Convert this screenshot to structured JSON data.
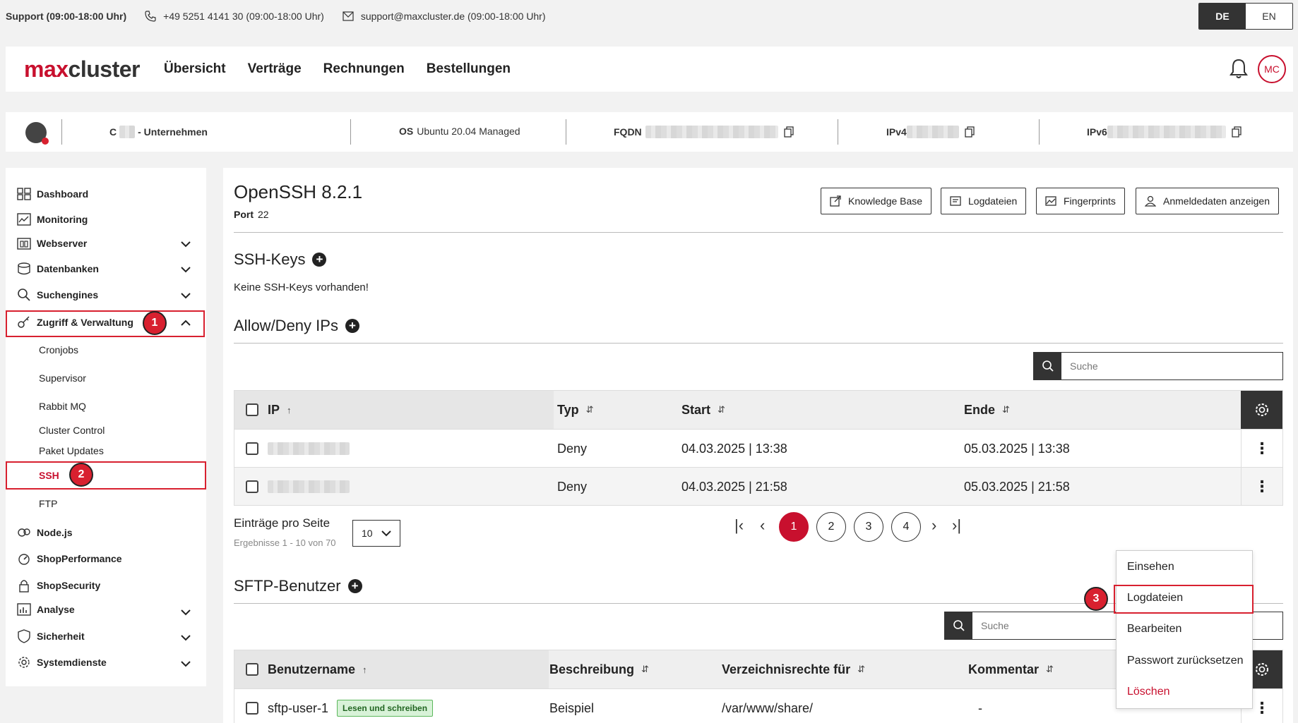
{
  "support": {
    "title": "Support (09:00-18:00 Uhr)",
    "phone": "+49 5251 4141 30 (09:00-18:00 Uhr)",
    "email": "support@maxcluster.de (09:00-18:00 Uhr)"
  },
  "lang": {
    "de": "DE",
    "en": "EN"
  },
  "header": {
    "logo_a": "max",
    "logo_b": "cluster",
    "nav": [
      "Übersicht",
      "Verträge",
      "Rechnungen",
      "Bestellungen"
    ],
    "avatar": "MC"
  },
  "server": {
    "name_prefix": "C",
    "name_suffix": "- Unternehmen",
    "os_label": "OS",
    "os_value": "Ubuntu 20.04 Managed",
    "fqdn_label": "FQDN",
    "ipv4_label": "IPv4",
    "ipv6_label": "IPv6"
  },
  "sidebar": {
    "items": [
      "Dashboard",
      "Monitoring",
      "Webserver",
      "Datenbanken",
      "Suchengines",
      "Zugriff & Verwaltung",
      "Node.js",
      "ShopPerformance",
      "ShopSecurity",
      "Analyse",
      "Sicherheit",
      "Systemdienste"
    ],
    "sub": [
      "Cronjobs",
      "Supervisor",
      "Rabbit MQ",
      "Cluster Control",
      "Paket Updates",
      "SSH",
      "FTP"
    ],
    "badge1": "1",
    "badge2": "2"
  },
  "main": {
    "title": "OpenSSH 8.2.1",
    "port_label": "Port",
    "port_value": "22",
    "buttons": [
      "Knowledge Base",
      "Logdateien",
      "Fingerprints",
      "Anmeldedaten anzeigen"
    ],
    "ssh_keys_title": "SSH-Keys",
    "ssh_keys_empty": "Keine SSH-Keys vorhanden!",
    "allow_title": "Allow/Deny IPs",
    "search_placeholder": "Suche",
    "ip_table": {
      "headers": [
        "IP",
        "Typ",
        "Start",
        "Ende"
      ],
      "sort": [
        "↑",
        "⇵",
        "⇵",
        "⇵"
      ],
      "rows": [
        {
          "typ": "Deny",
          "start": "04.03.2025 | 13:38",
          "ende": "05.03.2025 | 13:38"
        },
        {
          "typ": "Deny",
          "start": "04.03.2025 | 21:58",
          "ende": "05.03.2025 | 21:58"
        }
      ]
    },
    "per_page_label": "Einträge pro Seite",
    "results": "Ergebnisse 1 - 10 von 70",
    "per_page_value": "10",
    "pages": [
      "1",
      "2",
      "3",
      "4"
    ],
    "sftp_title": "SFTP-Benutzer",
    "sftp_table": {
      "headers": [
        "Benutzername",
        "Beschreibung",
        "Verzeichnisrechte für",
        "Kommentar"
      ],
      "sort": [
        "↑",
        "⇵",
        "⇵",
        "⇵"
      ],
      "row": {
        "user": "sftp-user-1",
        "tag": "Lesen und schreiben",
        "desc": "Beispiel",
        "dir": "/var/www/share/",
        "comment": "-"
      }
    }
  },
  "menu": {
    "items": [
      "Einsehen",
      "Logdateien",
      "Bearbeiten",
      "Passwort zurücksetzen",
      "Löschen"
    ],
    "badge3": "3"
  },
  "colors": {
    "brand": "#c8102e",
    "highlight": "#d8202f",
    "dark": "#333333"
  }
}
